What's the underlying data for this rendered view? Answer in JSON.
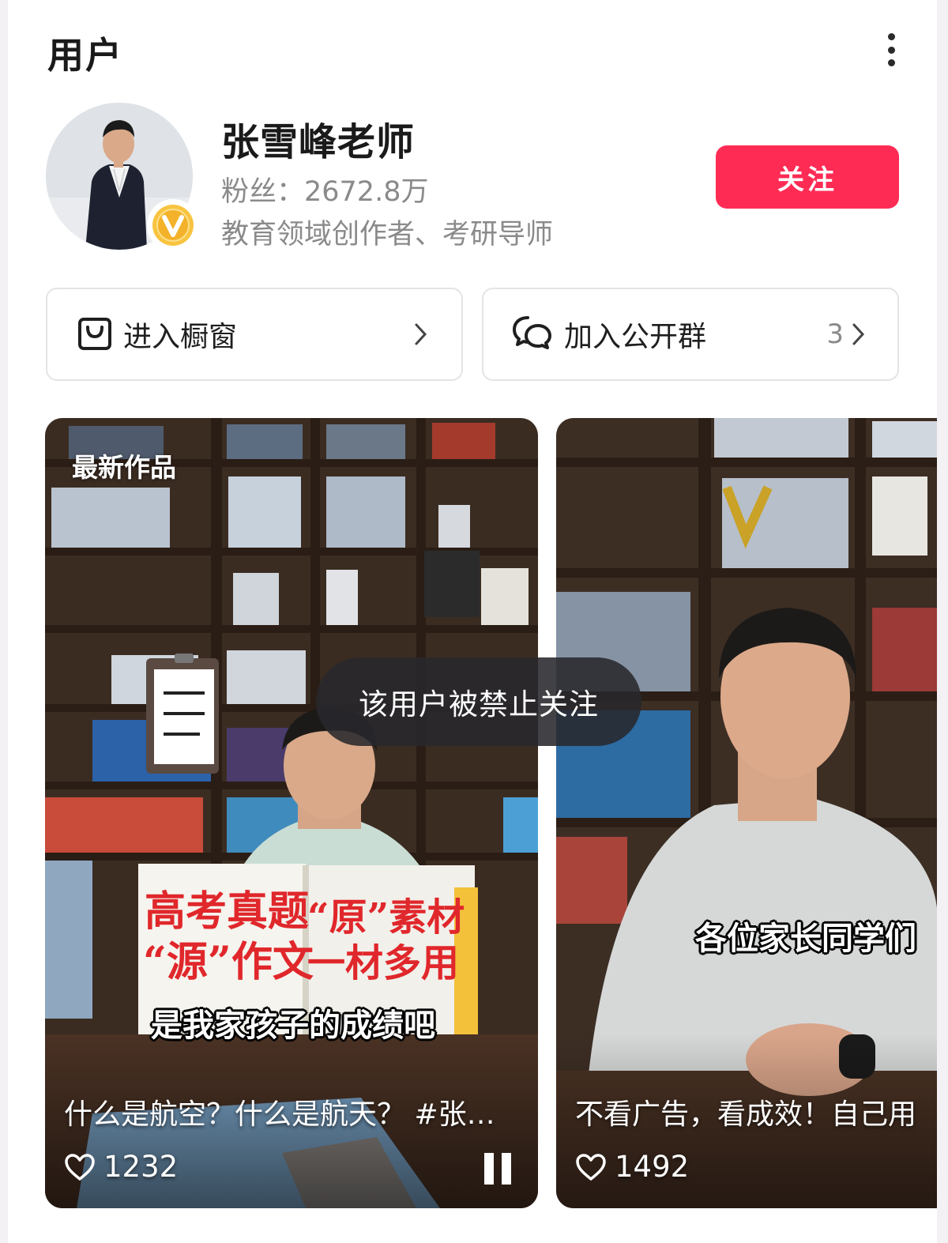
{
  "header": {
    "title": "用户",
    "more_icon": "more-vertical-icon"
  },
  "profile": {
    "name": "张雪峰老师",
    "fans": "粉丝：2672.8万",
    "description": "教育领域创作者、考研导师",
    "verified_icon": "verified-v-icon",
    "follow_label": "关注"
  },
  "actions": {
    "shop": {
      "icon": "shopping-bag-icon",
      "label": "进入橱窗"
    },
    "group": {
      "icon": "chat-bubbles-icon",
      "label": "加入公开群",
      "count": "3"
    }
  },
  "videos": [
    {
      "badge": "最新作品",
      "overlay_subtitle": "是我家孩子的成绩吧",
      "book_title_left_line1": "高考真题",
      "book_title_left_line2": "“源”作文",
      "book_title_right_line1": "“原”素材",
      "book_title_right_line2": "一材多用",
      "caption": "什么是航空？什么是航天？ #张…",
      "likes": "1232"
    },
    {
      "overlay_subtitle": "各位家长同学们",
      "caption": "不看广告，看成效！自己用",
      "likes": "1492"
    }
  ],
  "toast": "该用户被禁止关注",
  "colors": {
    "accent": "#fe2c55",
    "text_secondary": "#8a8a8a",
    "border": "#e4e4e4",
    "badge_gold": "#f5b81c"
  }
}
